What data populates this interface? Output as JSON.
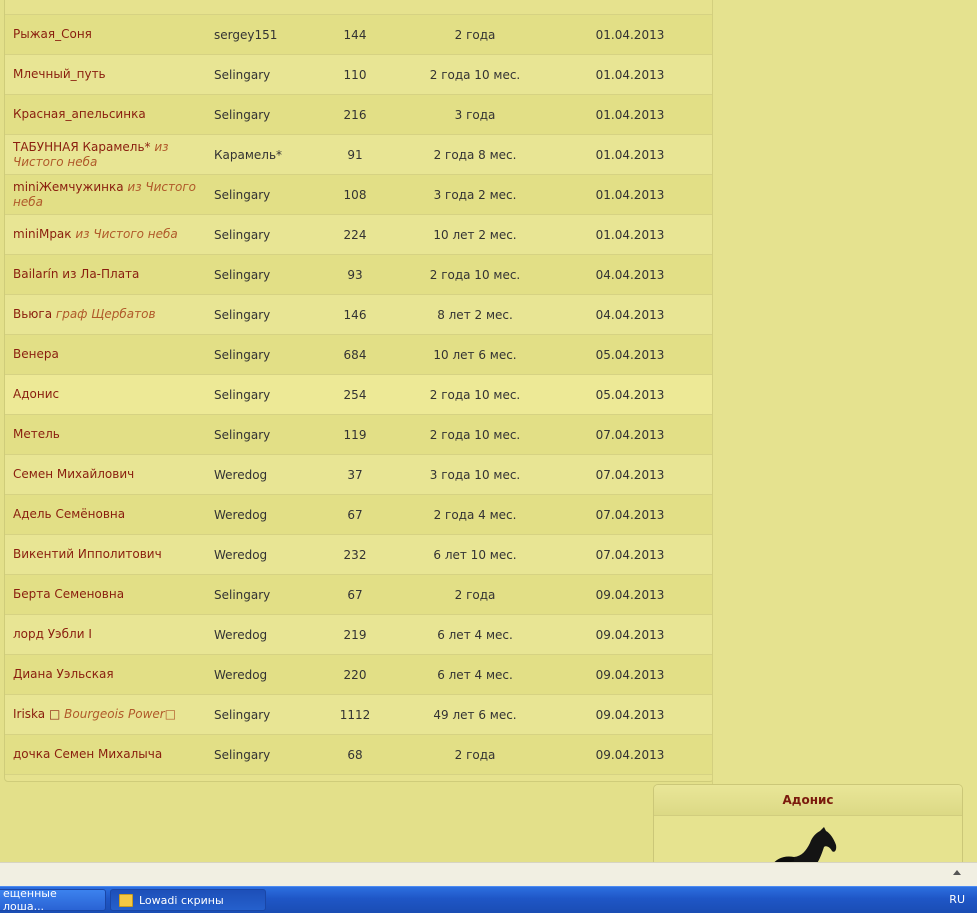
{
  "table": {
    "rows": [
      {
        "name": "Рыжая_Соня",
        "suffix": "",
        "owner": "sergey151",
        "num": "144",
        "age": "2 года",
        "date": "01.04.2013"
      },
      {
        "name": "Млечный_путь",
        "suffix": "",
        "owner": "Selingary",
        "num": "110",
        "age": "2 года 10 мес.",
        "date": "01.04.2013"
      },
      {
        "name": "Красная_апельсинка",
        "suffix": "",
        "owner": "Selingary",
        "num": "216",
        "age": "3 года",
        "date": "01.04.2013"
      },
      {
        "name": "ТАБУННАЯ Карамель*",
        "suffix": "из Чистого неба",
        "owner": "Карамель*",
        "num": "91",
        "age": "2 года 8 мес.",
        "date": "01.04.2013"
      },
      {
        "name": "miniЖемчужинка",
        "suffix": "из Чистого неба",
        "owner": "Selingary",
        "num": "108",
        "age": "3 года 2 мес.",
        "date": "01.04.2013"
      },
      {
        "name": "miniМрак",
        "suffix": "из Чистого неба",
        "owner": "Selingary",
        "num": "224",
        "age": "10 лет 2 мес.",
        "date": "01.04.2013"
      },
      {
        "name": "Bailarín из Ла-Плата",
        "suffix": "",
        "owner": "Selingary",
        "num": "93",
        "age": "2 года 10 мес.",
        "date": "04.04.2013"
      },
      {
        "name": "Вьюга",
        "suffix": "граф Щербатов",
        "owner": "Selingary",
        "num": "146",
        "age": "8 лет 2 мес.",
        "date": "04.04.2013"
      },
      {
        "name": "Венера",
        "suffix": "",
        "owner": "Selingary",
        "num": "684",
        "age": "10 лет 6 мес.",
        "date": "05.04.2013"
      },
      {
        "name": "Адонис",
        "suffix": "",
        "owner": "Selingary",
        "num": "254",
        "age": "2 года 10 мес.",
        "date": "05.04.2013"
      },
      {
        "name": "Метель",
        "suffix": "",
        "owner": "Selingary",
        "num": "119",
        "age": "2 года 10 мес.",
        "date": "07.04.2013"
      },
      {
        "name": "Семен Михайлович",
        "suffix": "",
        "owner": "Weredog",
        "num": "37",
        "age": "3 года 10 мес.",
        "date": "07.04.2013"
      },
      {
        "name": "Адель Семёновна",
        "suffix": "",
        "owner": "Weredog",
        "num": "67",
        "age": "2 года 4 мес.",
        "date": "07.04.2013"
      },
      {
        "name": "Викентий Ипполитович",
        "suffix": "",
        "owner": "Weredog",
        "num": "232",
        "age": "6 лет 10 мес.",
        "date": "07.04.2013"
      },
      {
        "name": "Берта Семеновна",
        "suffix": "",
        "owner": "Selingary",
        "num": "67",
        "age": "2 года",
        "date": "09.04.2013"
      },
      {
        "name": "лорд Уэбли I",
        "suffix": "",
        "owner": "Weredog",
        "num": "219",
        "age": "6 лет 4 мес.",
        "date": "09.04.2013"
      },
      {
        "name": "Диана Уэльская",
        "suffix": "",
        "owner": "Weredog",
        "num": "220",
        "age": "6 лет 4 мес.",
        "date": "09.04.2013"
      },
      {
        "name": "Iriska □",
        "suffix": "Bourgeois Power□",
        "owner": "Selingary",
        "num": "1112",
        "age": "49 лет 6 мес.",
        "date": "09.04.2013"
      },
      {
        "name": "дочка Семен Михалыча",
        "suffix": "",
        "owner": "Selingary",
        "num": "68",
        "age": "2 года",
        "date": "09.04.2013"
      }
    ],
    "highlighted_row": 9
  },
  "horse_card": {
    "title": "Адонис",
    "image_icon": "black-horse-icon"
  },
  "taskbar": {
    "items": [
      {
        "label": "ещенные лоша..."
      },
      {
        "label": "Lowadi скрины",
        "icon": "folder-icon"
      }
    ],
    "tray_lang": "RU"
  },
  "colors": {
    "name_link": "#8a1e0e",
    "background": "#e3e08a",
    "taskbar": "#2a63d4"
  }
}
